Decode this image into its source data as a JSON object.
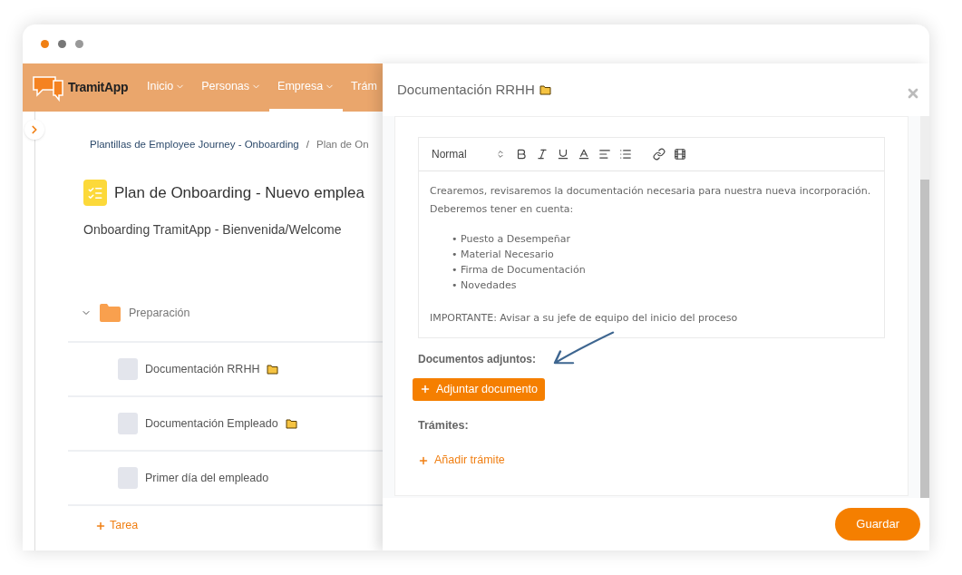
{
  "app": {
    "logo": "TramitApp",
    "nav": [
      {
        "label": "Inicio",
        "selected": false
      },
      {
        "label": "Personas",
        "selected": false
      },
      {
        "label": "Empresa",
        "selected": true
      },
      {
        "label": "Trám",
        "selected": false
      }
    ]
  },
  "breadcrumb": {
    "items": [
      "Plantillas de Employee Journey - Onboarding",
      "Plan de On"
    ],
    "separator": "/"
  },
  "page": {
    "title": "Plan de Onboarding - Nuevo emplea",
    "subtitle": "Onboarding TramitApp - Bienvenida/Welcome"
  },
  "group": {
    "name": "Preparación",
    "expanded": true,
    "tasks": [
      {
        "name": "Documentación RRHH",
        "attachment": true,
        "checked": false
      },
      {
        "name": "Documentación Empleado",
        "attachment": true,
        "checked": false
      },
      {
        "name": "Primer día del empleado",
        "attachment": false,
        "checked": false
      }
    ],
    "add_task": "Tarea"
  },
  "drawer": {
    "title": "Documentación RRHH",
    "title_attachment": true,
    "toolbar": {
      "format": "Normal"
    },
    "editor": {
      "intro": "Crearemos, revisaremos la documentación necesaria para nuestra nueva incorporación. Deberemos tener en cuenta:",
      "bullets": [
        "• Puesto a Desempeñar",
        "• Material Necesario",
        "• Firma de Documentación",
        "• Novedades"
      ],
      "note": "IMPORTANTE: Avisar a su jefe de equipo del inicio del proceso"
    },
    "attachments_label": "Documentos adjuntos:",
    "attach_button": "Adjuntar documento",
    "procedures_label": "Trámites:",
    "add_procedure": "Añadir trámite",
    "save_button": "Guardar"
  }
}
